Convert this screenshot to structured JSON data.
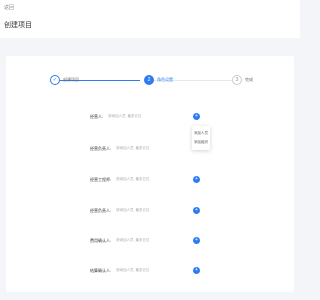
{
  "header": {
    "back_label": "返回",
    "title": "创建项目"
  },
  "stepper": {
    "steps": [
      {
        "index": "✓",
        "label": "创建项目",
        "state": "finished"
      },
      {
        "index": "2",
        "label": "角色设置",
        "state": "active"
      },
      {
        "index": "3",
        "label": "完成",
        "state": "waiting"
      }
    ]
  },
  "form": {
    "rows": [
      {
        "label": "经营人:",
        "placeholder": "请添加人员, 最多五位"
      },
      {
        "label": "经营负责人:",
        "placeholder": "请添加人员, 最多五位"
      },
      {
        "label": "经营工程师:",
        "placeholder": "请添加人员, 最多五位"
      },
      {
        "label": "经营负责人:",
        "placeholder": "请添加人员, 最多五位"
      },
      {
        "label": "费用确认人:",
        "placeholder": "请添加人员, 最多五位"
      },
      {
        "label": "结算确认人:",
        "placeholder": "请添加人员, 最多五位"
      }
    ],
    "add_icon": "+"
  },
  "dropdown": {
    "items": [
      "添加人员",
      "添加组织"
    ]
  },
  "colors": {
    "accent": "#2f7bf5",
    "background": "#f4f5f8",
    "card": "#ffffff"
  }
}
